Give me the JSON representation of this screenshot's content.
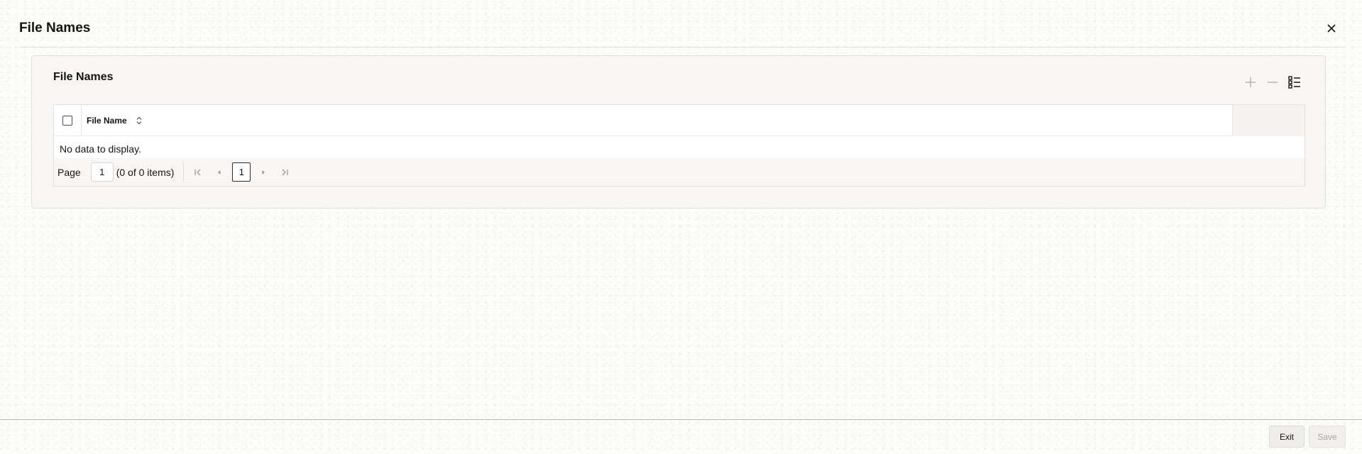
{
  "dialog": {
    "title": "File Names"
  },
  "panel": {
    "title": "File Names"
  },
  "toolbar": {
    "add_icon": "plus-icon",
    "remove_icon": "minus-icon",
    "columns_icon": "list-columns-icon"
  },
  "grid": {
    "columns": [
      {
        "label": "File Name",
        "sortable": true
      }
    ],
    "rows": [],
    "empty_message": "No data to display."
  },
  "pager": {
    "page_label": "Page",
    "page_value": "1",
    "count_text": "(0 of 0 items)",
    "current_page": "1"
  },
  "footer": {
    "exit_label": "Exit",
    "save_label": "Save"
  }
}
